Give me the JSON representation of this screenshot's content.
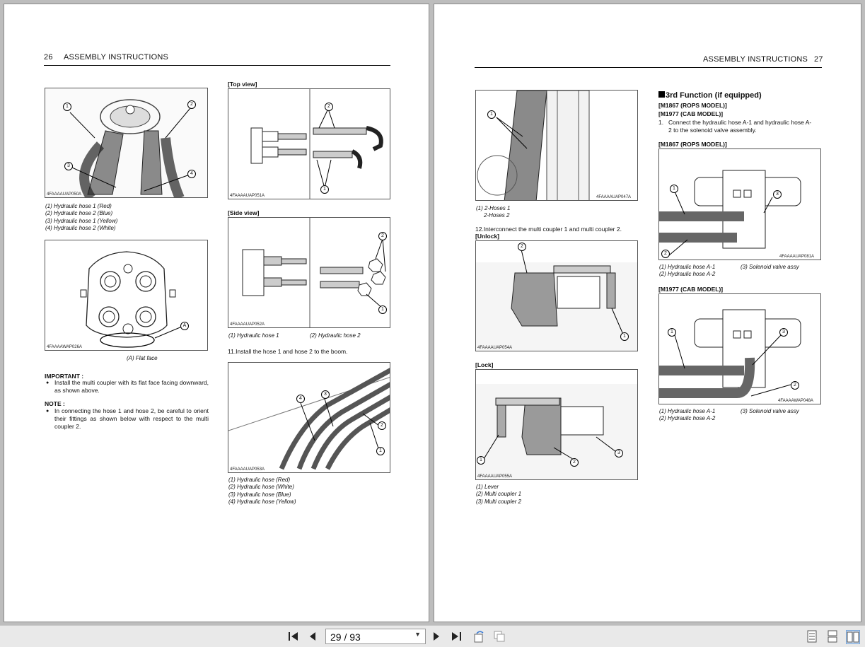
{
  "left_page": {
    "header_number": "26",
    "header_title": "ASSEMBLY INSTRUCTIONS",
    "fig1": {
      "code": "4FAAAAUAP050A",
      "captions": [
        "(1) Hydraulic hose 1 (Red)",
        "(2) Hydraulic hose 2 (Blue)",
        "(3) Hydraulic hose 1 (Yellow)",
        "(4) Hydraulic hose 2 (White)"
      ]
    },
    "fig2": {
      "code": "4FAAAAWAP026A",
      "caption": "(A) Flat face"
    },
    "important_label": "IMPORTANT :",
    "important_text": "Install the multi coupler with its flat face facing downward, as shown above.",
    "note_label": "NOTE :",
    "note_text": "In connecting the hose 1 and hose 2, be careful to orient their fittings as shown below with respect to the multi coupler 2.",
    "top_view_label": "[Top view]",
    "fig3_code": "4FAAAAUAP051A",
    "side_view_label": "[Side view]",
    "fig4": {
      "code": "4FAAAAUAP052A",
      "caption_1": "(1) Hydraulic hose 1",
      "caption_2": "(2) Hydraulic hose 2"
    },
    "step11": "11.Install the hose 1 and hose 2 to the boom.",
    "fig5": {
      "code": "4FAAAAUAP053A",
      "captions": [
        "(1) Hydraulic hose (Red)",
        "(2) Hydraulic hose (White)",
        "(3) Hydraulic hose (Blue)",
        "(4) Hydraulic hose (Yellow)"
      ]
    }
  },
  "right_page": {
    "header_title": "ASSEMBLY INSTRUCTIONS",
    "header_number": "27",
    "fig6": {
      "code": "4FAAAAUAP047A",
      "captions": [
        "(1) 2-Hoses 1",
        "2-Hoses 2"
      ]
    },
    "step12": "12.Interconnect the multi coupler 1 and multi coupler 2.",
    "unlock_label": "[Unlock]",
    "fig7_code": "4FAAAAUAP054A",
    "lock_label": "[Lock]",
    "fig8": {
      "code": "4FAAAAUAP055A",
      "captions": [
        "(1) Lever",
        "(2) Multi coupler 1",
        "(3) Multi coupler 2"
      ]
    },
    "section_title": "3rd Function (if equipped)",
    "model_1": "[M1867 (ROPS MODEL)]",
    "model_2": "[M1977 (CAB MODEL)]",
    "step1_num": "1.",
    "step1_text_a": "Connect the hydraulic hose A-1 and hydraulic hose A-",
    "step1_text_b": "2 to the solenoid valve assembly.",
    "rops_label": "[M1867 (ROPS MODEL)]",
    "fig9": {
      "code": "4FAAAAUAP081A",
      "cap_1": "(1) Hydraulic hose A-1",
      "cap_2": "(2) Hydraulic hose A-2",
      "cap_3": "(3) Solenoid valve assy"
    },
    "cab_label": "[M1977 (CAB MODEL)]",
    "fig10": {
      "code": "4FAAAAWAP048A",
      "cap_1": "(1) Hydraulic hose A-1",
      "cap_2": "(2) Hydraulic hose A-2",
      "cap_3": "(3) Solenoid valve assy"
    }
  },
  "callouts": {
    "n1": "1",
    "n2": "2",
    "n3": "3",
    "n4": "4",
    "A": "A"
  },
  "toolbar": {
    "page_indicator": "29 / 93",
    "icons": [
      "first-page-icon",
      "prev-page-icon",
      "next-page-icon",
      "last-page-icon",
      "rotate-icon",
      "fit-page-icon",
      "single-page-icon",
      "continuous-page-icon",
      "two-page-icon"
    ]
  }
}
